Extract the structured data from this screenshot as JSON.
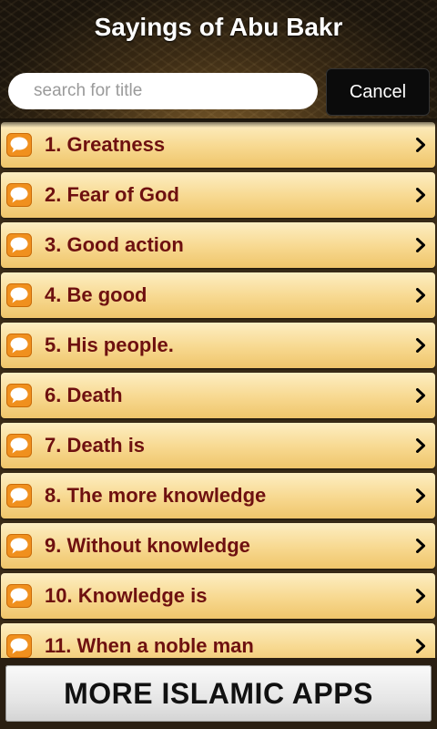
{
  "header": {
    "title": "Sayings of Abu Bakr"
  },
  "search": {
    "placeholder": "search for title",
    "value": "",
    "cancel_label": "Cancel"
  },
  "list": {
    "items": [
      {
        "label": "1. Greatness"
      },
      {
        "label": "2. Fear of God"
      },
      {
        "label": "3. Good action"
      },
      {
        "label": "4. Be good"
      },
      {
        "label": "5. His people."
      },
      {
        "label": "6. Death"
      },
      {
        "label": "7. Death is"
      },
      {
        "label": "8. The more knowledge"
      },
      {
        "label": "9. Without knowledge"
      },
      {
        "label": "10. Knowledge is"
      },
      {
        "label": "11. When a noble man"
      }
    ],
    "item_icon": "message-bubble-icon",
    "item_chevron": "chevron-right-icon"
  },
  "footer": {
    "button_label": "MORE ISLAMIC APPS"
  },
  "colors": {
    "item_text": "#6e1010",
    "item_bg_top": "#fdeec2",
    "item_bg_bottom": "#efc56b",
    "icon_orange": "#f0901e"
  }
}
